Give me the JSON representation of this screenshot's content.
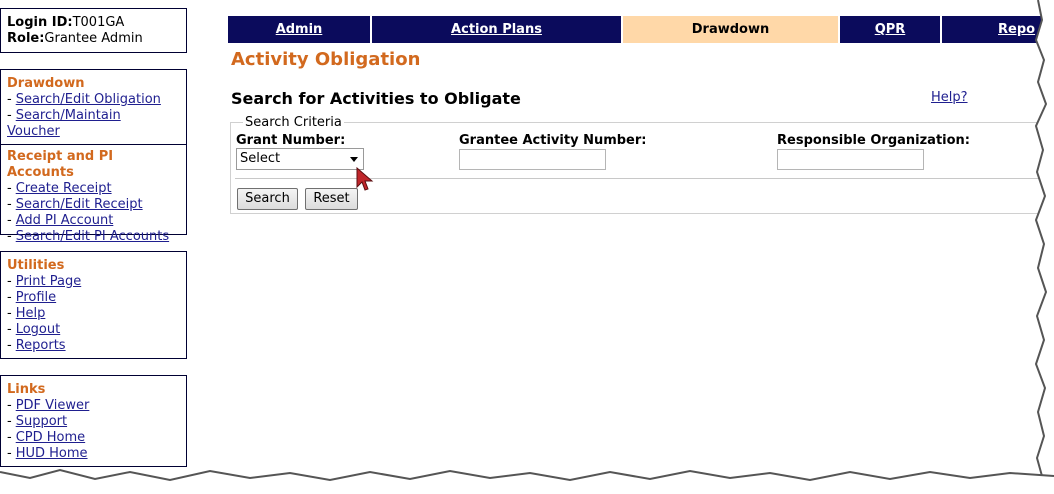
{
  "sidebar": {
    "login": {
      "id_label": "Login ID:",
      "id_value": "T001GA",
      "role_label": "Role:",
      "role_value": "Grantee Admin"
    },
    "drawdown": {
      "heading": "Drawdown",
      "items": [
        "Search/Edit Obligation",
        "Search/Maintain",
        "Voucher"
      ]
    },
    "receipt": {
      "heading": "Receipt and PI Accounts",
      "items": [
        "Create Receipt",
        "Search/Edit Receipt",
        "Add PI Account",
        "Search/Edit PI Accounts"
      ]
    },
    "utilities": {
      "heading": "Utilities",
      "items": [
        "Print Page",
        "Profile",
        "Help",
        "Logout",
        "Reports"
      ]
    },
    "links": {
      "heading": "Links",
      "items": [
        "PDF Viewer",
        "Support",
        "CPD Home",
        "HUD Home"
      ]
    }
  },
  "nav": {
    "tabs": [
      "Admin",
      "Action Plans",
      "Drawdown",
      "QPR",
      "Repo"
    ],
    "active": "Drawdown"
  },
  "page_title": "Activity Obligation",
  "section_title": "Search for Activities to Obligate",
  "help_link": "Help?",
  "search": {
    "legend": "Search Criteria",
    "grant_number_label": "Grant Number:",
    "grant_number_value": "Select",
    "grantee_activity_label": "Grantee Activity Number:",
    "responsible_org_label": "Responsible Organization:",
    "search_button": "Search",
    "reset_button": "Reset"
  },
  "colors": {
    "nav_bg": "#0b0b5c",
    "active_tab": "#ffd8a8",
    "heading": "#d2691e"
  }
}
